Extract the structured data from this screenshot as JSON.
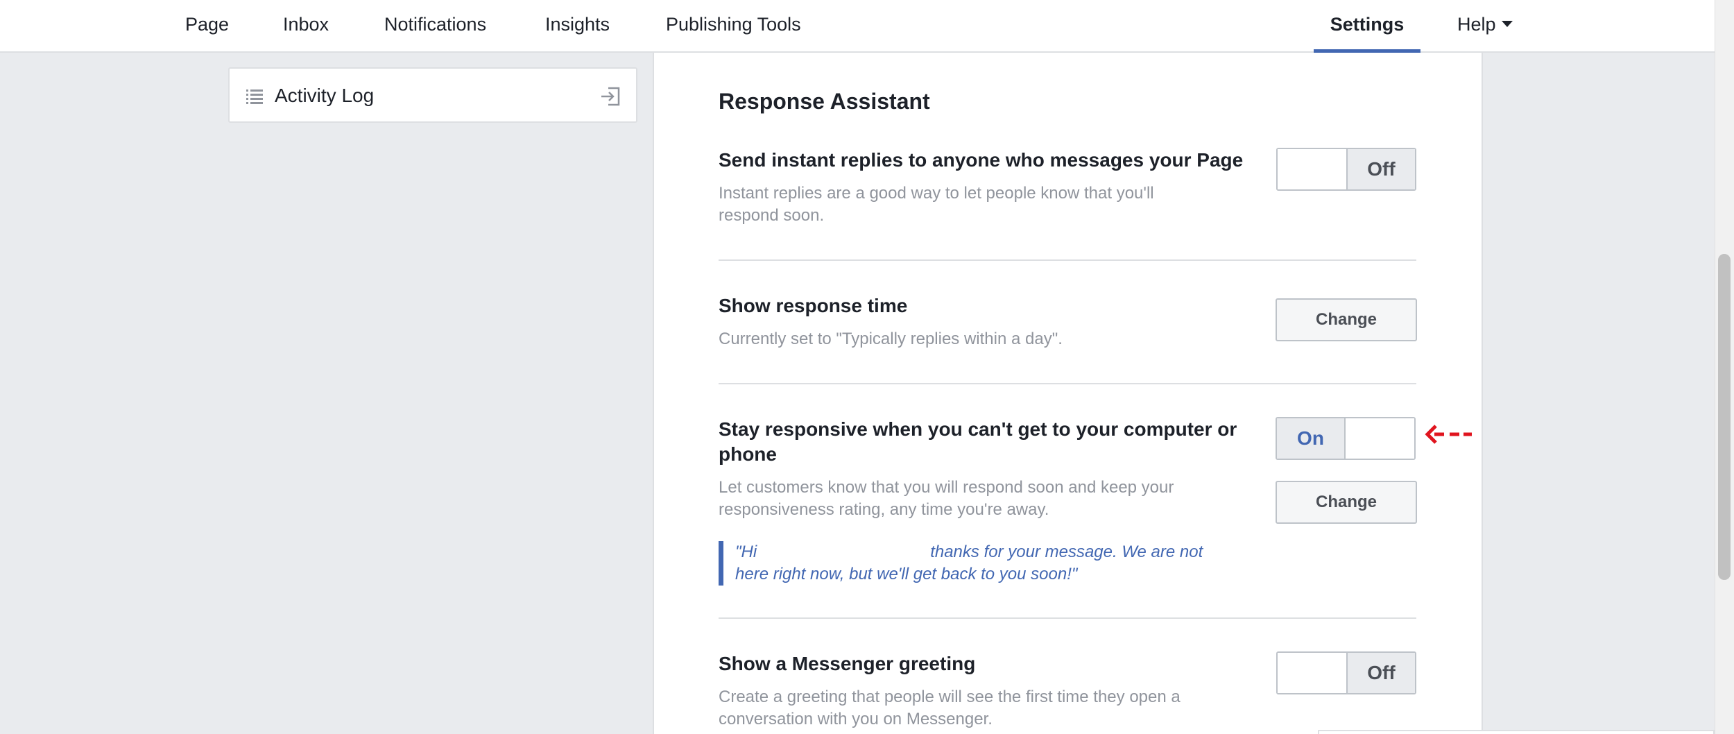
{
  "nav": {
    "items": [
      "Page",
      "Inbox",
      "Notifications",
      "Insights",
      "Publishing Tools"
    ],
    "settings": "Settings",
    "help": "Help"
  },
  "sidebar": {
    "activity_log": "Activity Log"
  },
  "section": {
    "title": "Response Assistant"
  },
  "rows": {
    "instant": {
      "title": "Send instant replies to anyone who messages your Page",
      "desc": "Instant replies are a good way to let people know that you'll respond soon.",
      "toggle_state": "Off"
    },
    "response_time": {
      "title": "Show response time",
      "desc": "Currently set to \"Typically replies within a day\".",
      "button": "Change"
    },
    "away": {
      "title": "Stay responsive when you can't get to your computer or phone",
      "desc": "Let customers know that you will respond soon and keep your responsiveness rating, any time you're away.",
      "toggle_state": "On",
      "button": "Change",
      "quote_start": "\"Hi",
      "quote_end": "thanks for your message. We are not here right now, but we'll get back to you soon!\""
    },
    "greeting": {
      "title": "Show a Messenger greeting",
      "desc": "Create a greeting that people will see the first time they open a conversation with you on Messenger.",
      "toggle_state": "Off"
    }
  },
  "colors": {
    "accent": "#4267b2",
    "annotation_arrow": "#e0141e"
  }
}
